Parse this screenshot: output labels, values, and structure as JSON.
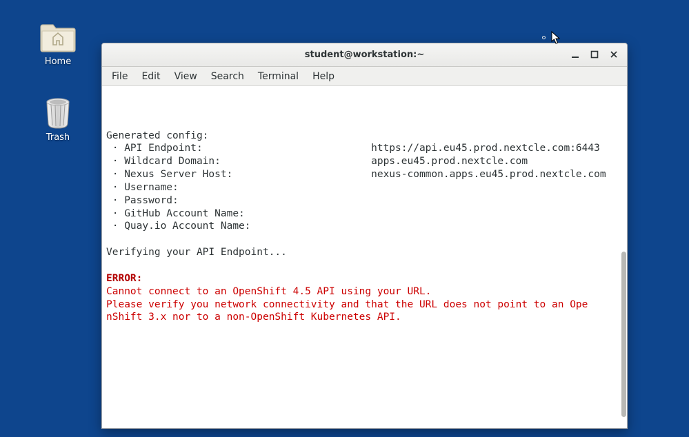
{
  "desktop": {
    "icons": [
      {
        "name": "home-folder",
        "label": "Home"
      },
      {
        "name": "trash",
        "label": "Trash"
      }
    ]
  },
  "window": {
    "title": "student@workstation:~",
    "menubar": [
      "File",
      "Edit",
      "View",
      "Search",
      "Terminal",
      "Help"
    ],
    "controls": {
      "minimize": "Minimize",
      "maximize": "Maximize",
      "close": "Close"
    }
  },
  "terminal": {
    "lines": [
      {
        "cls": "",
        "text": ""
      },
      {
        "cls": "",
        "text": "Generated config:"
      },
      {
        "cls": "",
        "text": " · API Endpoint:                            https://api.eu45.prod.nextcle.com:6443"
      },
      {
        "cls": "",
        "text": " · Wildcard Domain:                         apps.eu45.prod.nextcle.com"
      },
      {
        "cls": "",
        "text": " · Nexus Server Host:                       nexus-common.apps.eu45.prod.nextcle.com"
      },
      {
        "cls": "",
        "text": " · Username:"
      },
      {
        "cls": "",
        "text": " · Password:"
      },
      {
        "cls": "",
        "text": " · GitHub Account Name:"
      },
      {
        "cls": "",
        "text": " · Quay.io Account Name:"
      },
      {
        "cls": "",
        "text": ""
      },
      {
        "cls": "",
        "text": "Verifying your API Endpoint..."
      },
      {
        "cls": "",
        "text": ""
      },
      {
        "cls": "err-bold",
        "text": "ERROR:"
      },
      {
        "cls": "err",
        "text": "Cannot connect to an OpenShift 4.5 API using your URL."
      },
      {
        "cls": "err",
        "text": "Please verify you network connectivity and that the URL does not point to an Ope"
      },
      {
        "cls": "err",
        "text": "nShift 3.x nor to a non-OpenShift Kubernetes API."
      }
    ]
  }
}
